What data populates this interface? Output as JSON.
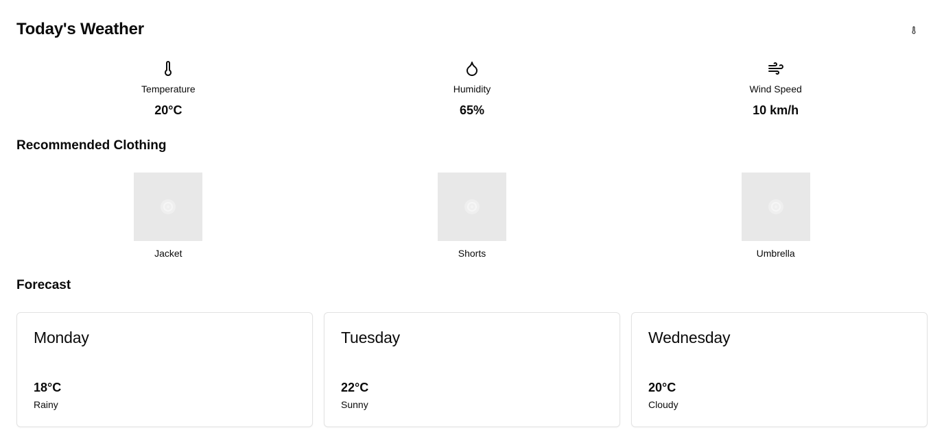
{
  "header": {
    "title": "Today's Weather",
    "unit_toggle_icon": "thermometer-icon"
  },
  "stats": [
    {
      "icon": "thermometer-icon",
      "label": "Temperature",
      "value": "20°C"
    },
    {
      "icon": "droplet-icon",
      "label": "Humidity",
      "value": "65%"
    },
    {
      "icon": "wind-icon",
      "label": "Wind Speed",
      "value": "10 km/h"
    }
  ],
  "clothing": {
    "title": "Recommended Clothing",
    "items": [
      {
        "label": "Jacket",
        "image": "image-placeholder"
      },
      {
        "label": "Shorts",
        "image": "image-placeholder"
      },
      {
        "label": "Umbrella",
        "image": "image-placeholder"
      }
    ]
  },
  "forecast": {
    "title": "Forecast",
    "days": [
      {
        "day": "Monday",
        "temp": "18°C",
        "condition": "Rainy"
      },
      {
        "day": "Tuesday",
        "temp": "22°C",
        "condition": "Sunny"
      },
      {
        "day": "Wednesday",
        "temp": "20°C",
        "condition": "Cloudy"
      }
    ]
  },
  "colors": {
    "text": "#0a0a0a",
    "placeholder_bg": "#e8e8e8",
    "card_border": "#e2e2e2"
  }
}
